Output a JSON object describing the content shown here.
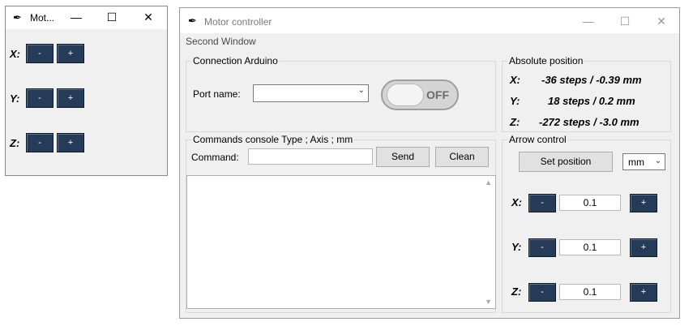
{
  "small_window": {
    "title": "Mot...",
    "minimize_glyph": "—",
    "maximize_glyph": "☐",
    "close_glyph": "✕",
    "rows": [
      {
        "axis": "X:",
        "minus": "-",
        "plus": "+"
      },
      {
        "axis": "Y:",
        "minus": "-",
        "plus": "+"
      },
      {
        "axis": "Z:",
        "minus": "-",
        "plus": "+"
      }
    ]
  },
  "main_window": {
    "title": "Motor controller",
    "minimize_glyph": "—",
    "maximize_glyph": "☐",
    "close_glyph": "✕",
    "menu": [
      "Second Window"
    ],
    "connection": {
      "group_label": "Connection Arduino",
      "port_label": "Port name:",
      "port_value": "",
      "toggle_text": "OFF"
    },
    "console": {
      "group_label": "Commands console Type ; Axis ; mm",
      "command_label": "Command:",
      "command_value": "",
      "send_label": "Send",
      "clean_label": "Clean",
      "output": ""
    },
    "absolute": {
      "group_label": "Absolute position",
      "rows": [
        {
          "axis": "X:",
          "value": "-36 steps / -0.39 mm"
        },
        {
          "axis": "Y:",
          "value": "18 steps / 0.2 mm"
        },
        {
          "axis": "Z:",
          "value": "-272 steps / -3.0 mm"
        }
      ]
    },
    "arrow": {
      "group_label": "Arrow control",
      "set_position_label": "Set position",
      "unit_value": "mm",
      "rows": [
        {
          "axis": "X:",
          "minus": "-",
          "value": "0.1",
          "plus": "+"
        },
        {
          "axis": "Y:",
          "minus": "-",
          "value": "0.1",
          "plus": "+"
        },
        {
          "axis": "Z:",
          "minus": "-",
          "value": "0.1",
          "plus": "+"
        }
      ]
    }
  },
  "colors": {
    "dark_button": "#263b57",
    "window_bg": "#f0f0f0"
  }
}
